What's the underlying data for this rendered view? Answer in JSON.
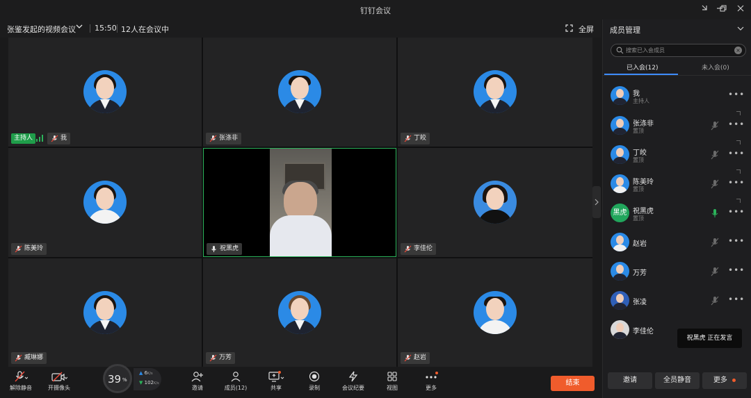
{
  "window": {
    "title": "钉钉会议"
  },
  "meeting": {
    "title": "张鉴发起的视频会议",
    "time": "15:50",
    "participant_count_text": "12人在会议中",
    "fullscreen_label": "全屏"
  },
  "grid": {
    "tiles": [
      {
        "name": "我",
        "host_badge": "主持人",
        "muted": true
      },
      {
        "name": "张涤非",
        "muted": true
      },
      {
        "name": "丁皎",
        "muted": true
      },
      {
        "name": "陈美玲",
        "muted": true
      },
      {
        "name": "祝黑虎",
        "muted": false,
        "video_on": true
      },
      {
        "name": "李佳伦",
        "muted": true
      },
      {
        "name": "臧琳娜",
        "muted": true
      },
      {
        "name": "万芳",
        "muted": true
      },
      {
        "name": "赵岩",
        "muted": true
      }
    ]
  },
  "panel": {
    "title": "成员管理",
    "search_placeholder": "搜索已入会成员",
    "tabs": {
      "joined": "已入会(12)",
      "not_joined": "未入会(0)"
    },
    "members": [
      {
        "name": "我",
        "sub": "主持人"
      },
      {
        "name": "张涤非",
        "sub": "置顶"
      },
      {
        "name": "丁皎",
        "sub": "置顶"
      },
      {
        "name": "陈美玲",
        "sub": "置顶"
      },
      {
        "name": "祝黑虎",
        "sub": "置顶",
        "avatar_text": "黑虎",
        "speaking": true
      },
      {
        "name": "赵岩",
        "sub": ""
      },
      {
        "name": "万芳",
        "sub": ""
      },
      {
        "name": "张凌",
        "sub": ""
      },
      {
        "name": "李佳伦",
        "sub": ""
      }
    ],
    "speaker_toast": "祝黑虎  正在发言",
    "buttons": {
      "invite": "邀请",
      "mute_all": "全员静音",
      "more": "更多"
    }
  },
  "toolbar": {
    "unmute": "解除静音",
    "camera": "开摄像头",
    "invite": "邀请",
    "members": "成员(12)",
    "share": "共享",
    "record": "录制",
    "minutes": "会议纪要",
    "view": "视图",
    "more": "更多",
    "end": "结束"
  },
  "network": {
    "percent": "39",
    "unit": "%",
    "up_rate": "6",
    "down_rate": "102",
    "rate_unit": "K/s"
  },
  "colors": {
    "accent_green": "#2bb35a",
    "end_button": "#f05c2c",
    "tab_blue": "#3d8cff",
    "avatar_blue": "#2b8ae6"
  }
}
